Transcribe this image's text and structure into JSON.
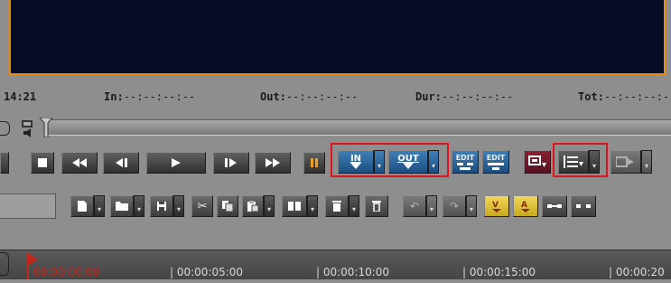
{
  "timecode_bar": {
    "time": "14:21",
    "in_label": "In:",
    "in_value": "--:--:--:--",
    "out_label": "Out:",
    "out_value": "--:--:--:--",
    "dur_label": "Dur:",
    "dur_value": "--:--:--:--",
    "tot_label": "Tot:",
    "tot_value": "--:--:--:--"
  },
  "transport": {
    "in_label": "IN",
    "out_label": "OUT",
    "edit1_line1": "EDIT",
    "edit2_line1": "EDIT"
  },
  "timeline": {
    "markers": [
      "00:00:00:00",
      "| 00:00:05:00",
      "| 00:00:10:00",
      "| 00:00:15:00",
      "| 00:00:20"
    ]
  },
  "colors": {
    "viewer_bg": "#050c24",
    "viewer_border": "#e68a12",
    "highlight_box": "#e0141c",
    "button_blue": "#2a6aa6",
    "timecode_red": "#c0281c"
  }
}
